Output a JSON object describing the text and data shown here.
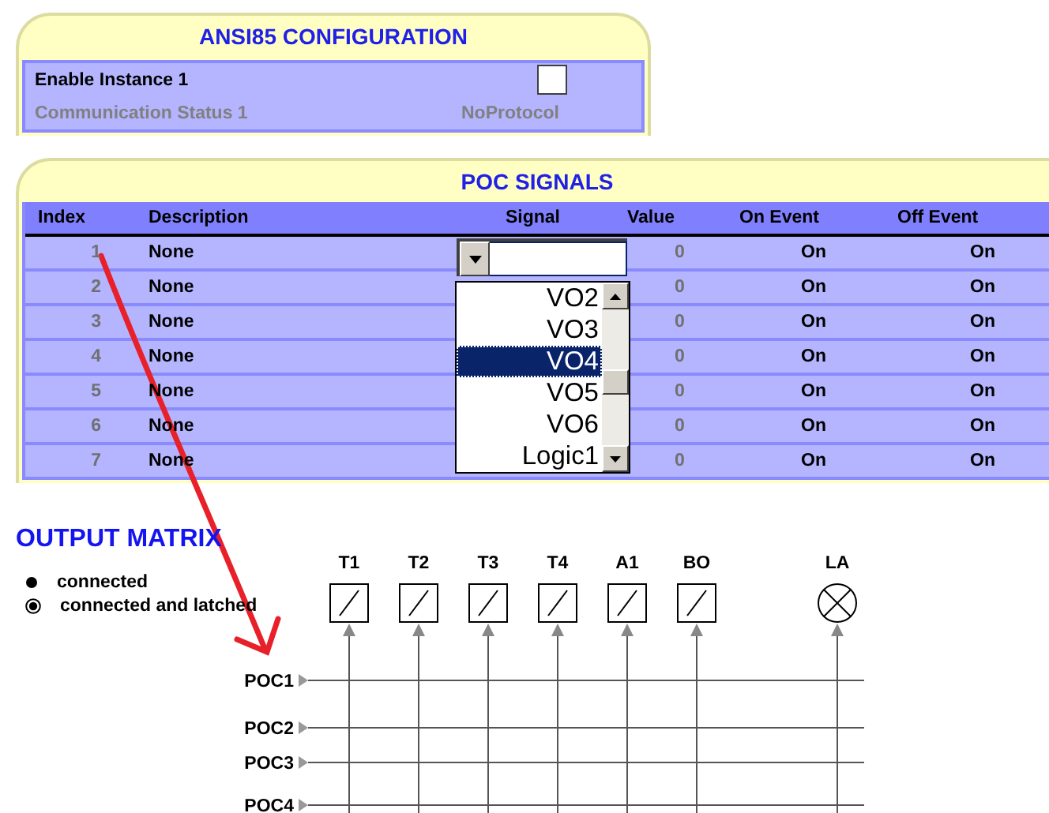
{
  "config_panel": {
    "title": "ANSI85 CONFIGURATION",
    "rows": [
      {
        "kind": "checkbox",
        "label": "Enable Instance 1",
        "checked": false,
        "disabled": false
      },
      {
        "kind": "status",
        "label": "Communication Status 1",
        "value": "NoProtocol",
        "disabled": true
      }
    ]
  },
  "poc_signals": {
    "title": "POC SIGNALS",
    "columns": [
      "Index",
      "Description",
      "Signal",
      "Value",
      "On Event",
      "Off Event"
    ],
    "rows": [
      {
        "index": "1",
        "description": "None",
        "value": "0",
        "on_event": "On",
        "off_event": "On"
      },
      {
        "index": "2",
        "description": "None",
        "value": "0",
        "on_event": "On",
        "off_event": "On"
      },
      {
        "index": "3",
        "description": "None",
        "value": "0",
        "on_event": "On",
        "off_event": "On"
      },
      {
        "index": "4",
        "description": "None",
        "value": "0",
        "on_event": "On",
        "off_event": "On"
      },
      {
        "index": "5",
        "description": "None",
        "value": "0",
        "on_event": "On",
        "off_event": "On"
      },
      {
        "index": "6",
        "description": "None",
        "value": "0",
        "on_event": "On",
        "off_event": "On"
      },
      {
        "index": "7",
        "description": "None",
        "value": "0",
        "on_event": "On",
        "off_event": "On"
      }
    ],
    "signal_dropdown": {
      "expanded": true,
      "options": [
        {
          "label": "VO2",
          "selected": false
        },
        {
          "label": "VO3",
          "selected": false
        },
        {
          "label": "VO4",
          "selected": true
        },
        {
          "label": "VO5",
          "selected": false
        },
        {
          "label": "VO6",
          "selected": false
        },
        {
          "label": "Logic1",
          "selected": false
        }
      ]
    }
  },
  "output_matrix": {
    "title": "OUTPUT MATRIX",
    "legend": [
      {
        "kind": "dot",
        "label": "connected"
      },
      {
        "kind": "ring",
        "label": "connected and latched"
      }
    ],
    "outputs": [
      {
        "kind": "contact",
        "label": "T1"
      },
      {
        "kind": "contact",
        "label": "T2"
      },
      {
        "kind": "contact",
        "label": "T3"
      },
      {
        "kind": "contact",
        "label": "T4"
      },
      {
        "kind": "contact",
        "label": "A1"
      },
      {
        "kind": "contact",
        "label": "BO"
      },
      {
        "kind": "lamp",
        "label": "LA"
      }
    ],
    "inputs": [
      "POC1",
      "POC2",
      "POC3",
      "POC4"
    ]
  }
}
